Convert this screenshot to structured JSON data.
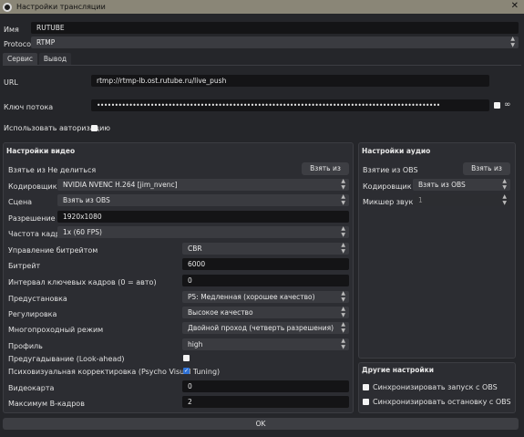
{
  "window": {
    "title": "Настройки трансляции"
  },
  "top": {
    "name_label": "Имя",
    "name_value": "RUTUBE",
    "protocol_label": "Protocol",
    "protocol_value": "RTMP"
  },
  "tabs": [
    {
      "label": "Сервис"
    },
    {
      "label": "Вывод"
    }
  ],
  "service": {
    "url_label": "URL",
    "url_value": "rtmp://rtmp-lb.ost.rutube.ru/live_push",
    "key_label": "Ключ потока",
    "key_value": "••••••••••••••••••••••••••••••••••••••••••••••••••••••••••••••••••••••••••••••••••••••••••••••••",
    "auth_label": "Использовать авторизацию"
  },
  "video": {
    "header": "Настройки видео",
    "take_from": "Взятье из Не делиться",
    "take_button": "Взять из",
    "encoder_label": "Кодировщик",
    "encoder_value": "NVIDIA NVENC H.264 [jim_nvenc]",
    "scene_label": "Сцена",
    "scene_value": "Взять из OBS",
    "resolution_label": "Разрешение",
    "resolution_value": "1920x1080",
    "fps_label": "Частота кадров",
    "fps_value": "1x (60 FPS)",
    "rate_control_label": "Управление битрейтом",
    "rate_control_value": "CBR",
    "bitrate_label": "Битрейт",
    "bitrate_value": "6000",
    "keyint_label": "Интервал ключевых кадров (0 = авто)",
    "keyint_value": "0",
    "preset_label": "Предустановка",
    "preset_value": "P5: Медленная (хорошее качество)",
    "tuning_label": "Регулировка",
    "tuning_value": "Высокое качество",
    "multipass_label": "Многопроходный режим",
    "multipass_value": "Двойной проход (четверть разрешения)",
    "profile_label": "Профиль",
    "profile_value": "high",
    "lookahead_label": "Предугадывание (Look-ahead)",
    "psycho_label": "Психовизуальная корректировка (Psycho Visual Tuning)",
    "gpu_label": "Видеокарта",
    "gpu_value": "0",
    "bframes_label": "Максимум B-кадров",
    "bframes_value": "2"
  },
  "audio": {
    "header": "Настройки аудио",
    "take_from": "Взятие из OBS",
    "take_button": "Взять из",
    "encoder_label": "Кодировщик",
    "encoder_value": "Взять из OBS",
    "mixer_label": "Микшер звука",
    "mixer_value": "1"
  },
  "other": {
    "header": "Другие настройки",
    "sync_start": "Синхронизировать запуск с OBS",
    "sync_stop": "Синхронизировать остановку с OBS"
  },
  "footer": {
    "ok": "OK"
  }
}
